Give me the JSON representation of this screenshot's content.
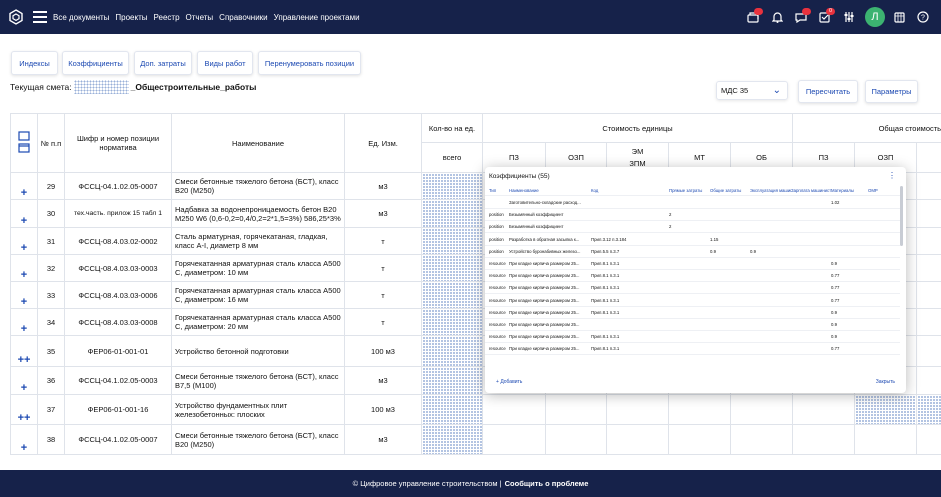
{
  "nav": [
    "Все документы",
    "Проекты",
    "Реестр",
    "Отчеты",
    "Справочники",
    "Управление проектами"
  ],
  "topbar": {
    "user_initial": "Л",
    "msg_badge": "",
    "task_badge": "0",
    "accent": "#16224a",
    "badge_color": "#e8323e"
  },
  "toolbar": [
    "Индексы",
    "Коэффициенты",
    "Доп. затраты",
    "Виды работ",
    "Перенумеровать позиции"
  ],
  "current": {
    "label": "Текущая смета:",
    "name": "_Общестроительные_работы"
  },
  "select": {
    "value": "МДС 35"
  },
  "buttons": {
    "recalc": "Пересчитать",
    "params": "Параметры"
  },
  "headers": {
    "num": "№ п.п",
    "code": "Шифр и номер позиции норматива",
    "name": "Наименование",
    "unit": "Ед. Изм.",
    "qty": "Кол-во на ед.",
    "qty_total": "всего",
    "unit_cost": "Стоимость единицы",
    "total_cost": "Общая стоимость",
    "pz": "ПЗ",
    "ozp": "ОЗП",
    "em": "ЭМ",
    "zpm": "ЗПМ",
    "mt": "МТ",
    "ob": "ОБ",
    "pz2": "ПЗ",
    "ozp2": "ОЗП"
  },
  "rows": [
    {
      "num": "29",
      "code": "ФССЦ-04.1.02.05-0007",
      "name": "Смеси бетонные тяжелого бетона (БСТ), класс В20 (М250)",
      "unit": "м3"
    },
    {
      "num": "30",
      "code": "тех.часть. прилож 15 табл 1",
      "name": "Надбавка за водонепроницаемость бетон В20 М250 W6 (0,6-0,2=0,4/0,2=2*1,5=3%) 586,25*3%",
      "unit": "м3"
    },
    {
      "num": "31",
      "code": "ФССЦ-08.4.03.02-0002",
      "name": "Сталь арматурная, горячекатаная, гладкая, класс A-I, диаметр 8 мм",
      "unit": "т"
    },
    {
      "num": "32",
      "code": "ФССЦ-08.4.03.03-0003",
      "name": "Горячекатанная арматурная сталь класса А500 С, диаметром: 10 мм",
      "unit": "т"
    },
    {
      "num": "33",
      "code": "ФССЦ-08.4.03.03-0006",
      "name": "Горячекатанная арматурная сталь класса А500 С, диаметром: 16 мм",
      "unit": "т"
    },
    {
      "num": "34",
      "code": "ФССЦ-08.4.03.03-0008",
      "name": "Горячекатанная арматурная сталь класса А500 С, диаметром: 20 мм",
      "unit": "т"
    },
    {
      "num": "35",
      "code": "ФЕР06-01-001-01",
      "name": "Устройство бетонной подготовки",
      "unit": "100 м3"
    },
    {
      "num": "36",
      "code": "ФССЦ-04.1.02.05-0003",
      "name": "Смеси бетонные тяжелого бетона (БСТ), класс В7,5 (М100)",
      "unit": "м3"
    },
    {
      "num": "37",
      "code": "ФЕР06-01-001-16",
      "name": "Устройство фундаментных плит железобетонных: плоских",
      "unit": "100 м3"
    },
    {
      "num": "38",
      "code": "ФССЦ-04.1.02.05-0007",
      "name": "Смеси бетонные тяжелого бетона (БСТ), класс В20 (М250)",
      "unit": "м3"
    }
  ],
  "modal": {
    "title": "Коэффициенты (55)",
    "headers": [
      "Тип",
      "Наименование",
      "Код",
      "Прямые затраты",
      "Общие затраты",
      "Эксплуатация машин",
      "Зарплата машиниста",
      "Материалы",
      "ОМР"
    ],
    "rows": [
      [
        "",
        "Заготовительно-складские расход...",
        "",
        "",
        "",
        "",
        "",
        "1.02",
        ""
      ],
      [
        "position",
        "Безымянный коэффициент",
        "",
        "2",
        "",
        "",
        "",
        "",
        ""
      ],
      [
        "position",
        "Безымянный коэффициент",
        "",
        "2",
        "",
        "",
        "",
        "",
        ""
      ],
      [
        "position",
        "Разработка в обратная засыпка к...",
        "Прил.3.12 п.3.184",
        "",
        "1.15",
        "",
        "",
        "",
        ""
      ],
      [
        "position",
        "Устройство буронабивных железо...",
        "Прил.5.5 п.3.7",
        "",
        "0.9",
        "0.9",
        "",
        "",
        ""
      ],
      [
        "resource",
        "При кладке кирпича размером 25...",
        "Прил.8.1 п.3.1",
        "",
        "",
        "",
        "",
        "0.9",
        ""
      ],
      [
        "resource",
        "При кладке кирпича размером 25...",
        "Прил.8.1 п.3.1",
        "",
        "",
        "",
        "",
        "0.77",
        ""
      ],
      [
        "resource",
        "При кладке кирпича размером 25...",
        "Прил.8.1 п.3.1",
        "",
        "",
        "",
        "",
        "0.77",
        ""
      ],
      [
        "resource",
        "При кладке кирпича размером 25...",
        "Прил.8.1 п.3.1",
        "",
        "",
        "",
        "",
        "0.77",
        ""
      ],
      [
        "resource",
        "При кладке кирпича размером 25...",
        "Прил.8.1 п.3.1",
        "",
        "",
        "",
        "",
        "0.9",
        ""
      ],
      [
        "resource",
        "При кладке кирпича размером 25...",
        "",
        "",
        "",
        "",
        "",
        "0.9",
        ""
      ],
      [
        "resource",
        "При кладке кирпича размером 25...",
        "Прил.8.1 п.3.1",
        "",
        "",
        "",
        "",
        "0.9",
        ""
      ],
      [
        "resource",
        "При кладке кирпича размером 25...",
        "Прил.8.1 п.3.1",
        "",
        "",
        "",
        "",
        "0.77",
        ""
      ]
    ],
    "add": "Добавить",
    "close": "Закрыть"
  },
  "footer": {
    "copy": "© Цифровое управление строительством |",
    "report": "Сообщить о проблеме"
  }
}
